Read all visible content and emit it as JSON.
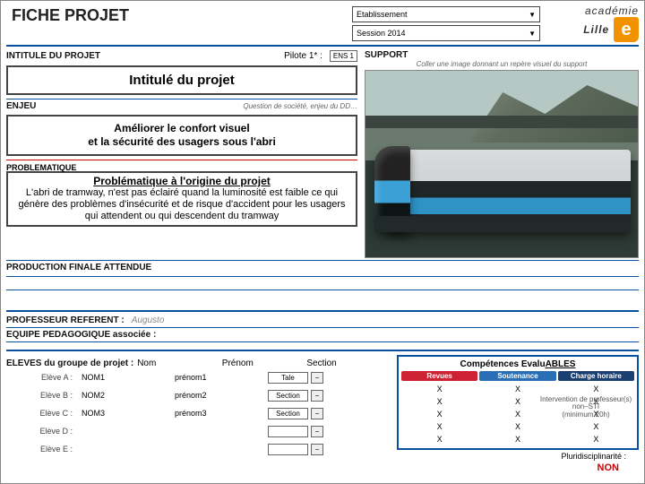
{
  "header": {
    "title": "FICHE PROJET",
    "dropdown1": "Etablissement",
    "dropdown2": "Session 2014"
  },
  "logo": {
    "word1": "académie",
    "word2": "Lille",
    "letter": "e"
  },
  "left": {
    "intitule_label": "INTITULE DU PROJET",
    "pilote_label": "Pilote 1* :",
    "pilote_value": "ENS 1",
    "box_title": "Intitulé du projet",
    "enjeu_label": "ENJEU",
    "enjeu_hint": "Question de société, enjeu du DD…",
    "enjeu_text1": "Améliorer le confort visuel",
    "enjeu_text2": "et la sécurité des usagers sous l'abri",
    "prob_label": "PROBLEMATIQUE",
    "prob_title": "Problématique à l'origine du projet",
    "prob_body": "L'abri de tramway, n'est pas éclairé quand la luminosité est faible ce qui génère des problèmes d'insécurité et de risque d'accident pour les usagers qui attendent ou qui descendent du tramway",
    "prod_label": "PRODUCTION FINALE ATTENDUE",
    "prof_label": "PROFESSEUR REFERENT :",
    "prof_value": "Augusto",
    "equipe_label": "EQUIPE PEDAGOGIQUE associée :"
  },
  "right": {
    "support_label": "SUPPORT",
    "support_hint": "Coller une image donnant un repère visuel du support"
  },
  "eleves": {
    "label": "ELEVES du groupe de projet :",
    "cols": {
      "nom": "Nom",
      "prenom": "Prénom",
      "section": "Section"
    },
    "rows": [
      {
        "lab": "Elève A :",
        "nom": "NOM1",
        "pre": "prénom1",
        "sec": "Tale"
      },
      {
        "lab": "Elève B :",
        "nom": "NOM2",
        "pre": "prénom2",
        "sec": "Section"
      },
      {
        "lab": "Elève C :",
        "nom": "NOM3",
        "pre": "prénom3",
        "sec": "Section"
      },
      {
        "lab": "Elève D :",
        "nom": "",
        "pre": "",
        "sec": ""
      },
      {
        "lab": "Elève E :",
        "nom": "",
        "pre": "",
        "sec": ""
      }
    ]
  },
  "competences": {
    "title_a": "Compétences Evalu",
    "title_b": "ABLES",
    "headers": [
      "Revues",
      "Soutenance",
      "Charge horaire"
    ],
    "x": "X",
    "pluri": "Pluridisciplinarité :",
    "side1": "Intervention de professeur(s) non–STI",
    "side2": "(minimum 20h)",
    "non": "NON"
  }
}
